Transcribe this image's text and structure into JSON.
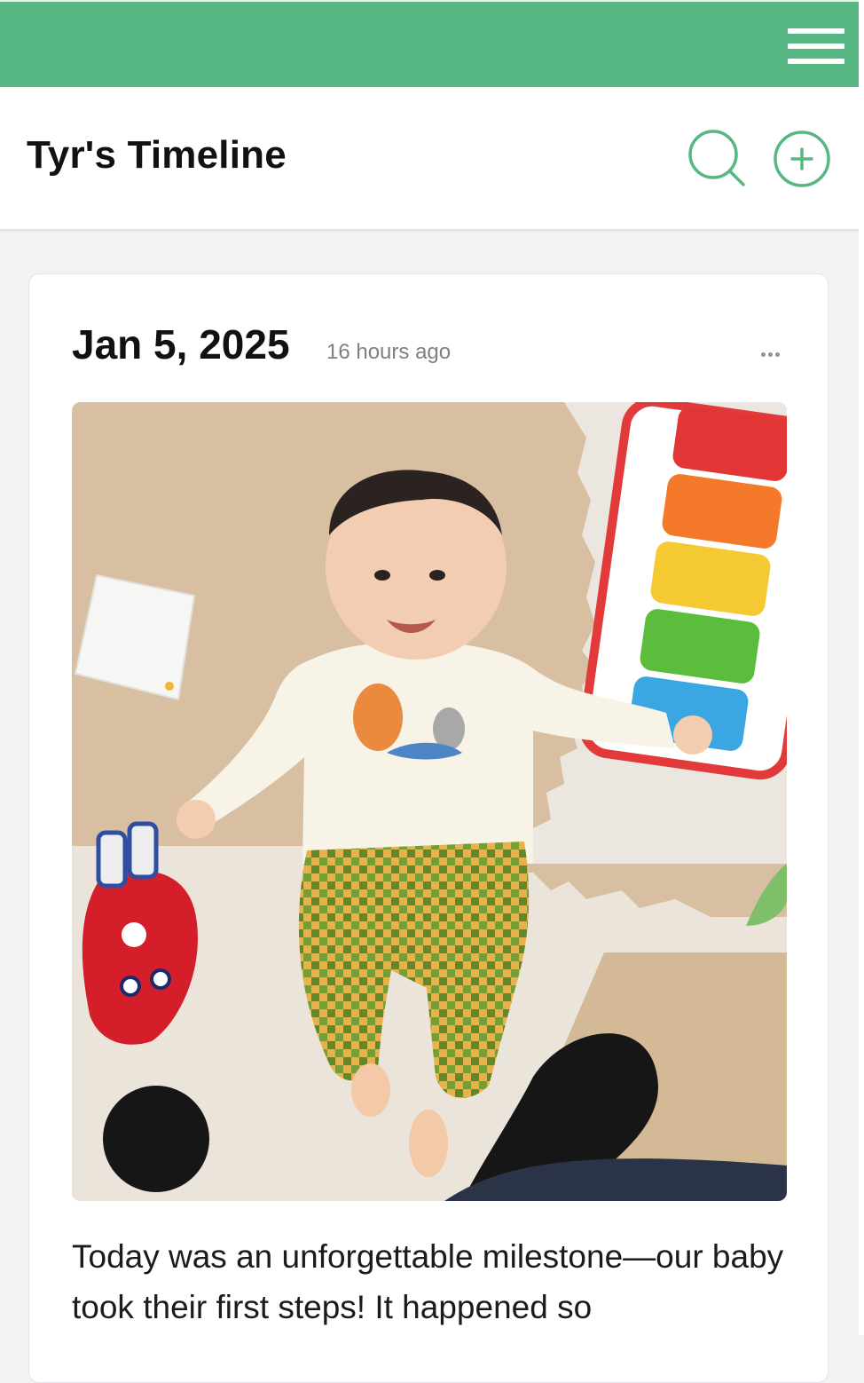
{
  "theme": {
    "accent": "#57b782",
    "header_bg": "#ffffff",
    "page_bg": "#f2f3f5",
    "text": "#111111",
    "muted": "#7b7f86"
  },
  "topbar": {
    "menu_icon": "hamburger-menu-icon"
  },
  "header": {
    "title": "Tyr's Timeline",
    "search_icon": "search-icon",
    "add_icon": "plus-circle-icon"
  },
  "post": {
    "date": "Jan 5, 2025",
    "relative_time": "16 hours ago",
    "more_icon": "more-horizontal-icon",
    "text": "Today was an unforgettable milestone—our baby took their first steps! It happened so"
  }
}
